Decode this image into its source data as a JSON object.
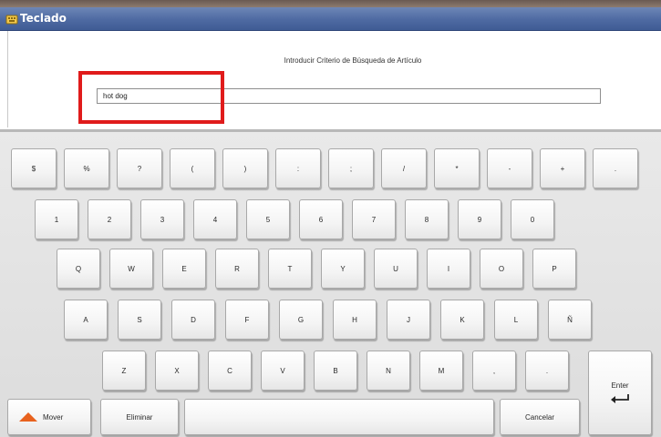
{
  "window": {
    "title": "Teclado"
  },
  "search": {
    "prompt": "Introducir Criterio de Búsqueda de Artículo",
    "value": "hot dog"
  },
  "colors": {
    "highlight": "#e01b1b",
    "titlebar": "#4e6aa2",
    "mover_arrow": "#e8621e"
  },
  "keyboard": {
    "row1": [
      "$",
      "%",
      "?",
      "(",
      ")",
      ":",
      ";",
      "/",
      "*",
      "-",
      "+",
      "."
    ],
    "row2": [
      "1",
      "2",
      "3",
      "4",
      "5",
      "6",
      "7",
      "8",
      "9",
      "0"
    ],
    "row3": [
      "Q",
      "W",
      "E",
      "R",
      "T",
      "Y",
      "U",
      "I",
      "O",
      "P"
    ],
    "row4": [
      "A",
      "S",
      "D",
      "F",
      "G",
      "H",
      "J",
      "K",
      "L",
      "Ñ"
    ],
    "row5": [
      "Z",
      "X",
      "C",
      "V",
      "B",
      "N",
      "M",
      ",",
      "."
    ],
    "mover_label": "Mover",
    "mover_icon": "arrow-up-icon",
    "eliminar_label": "Eliminar",
    "space_label": "",
    "cancelar_label": "Cancelar",
    "enter_label": "Enter",
    "enter_icon": "return-arrow-icon"
  }
}
